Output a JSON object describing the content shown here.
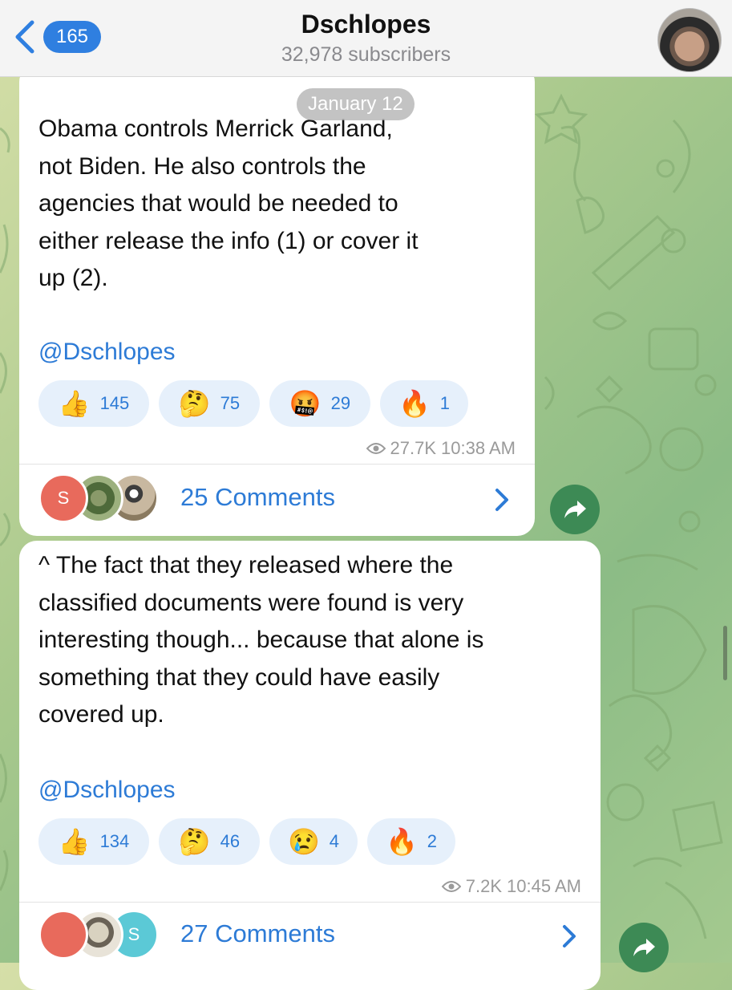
{
  "header": {
    "back_count": "165",
    "channel_name": "Dschlopes",
    "subscribers": "32,978 subscribers"
  },
  "date_separator": "January 12",
  "messages": [
    {
      "text": "Obama controls Merrick Garland,\nnot Biden.  He also controls the\nagencies that would be needed to\neither release the info (1) or cover it\nup (2).",
      "mention": "@Dschlopes",
      "reactions": [
        {
          "emoji": "👍",
          "count": "145"
        },
        {
          "emoji": "🤔",
          "count": "75"
        },
        {
          "emoji": "🤬",
          "count": "29"
        },
        {
          "emoji": "🔥",
          "count": "1"
        }
      ],
      "views": "27.7K",
      "time": "10:38 AM",
      "comments": "25 Comments",
      "comment_avatar_letter": "S"
    },
    {
      "text": "^ The fact that they released where the\nclassified documents were found is very\ninteresting though... because that alone is\nsomething that they could have easily\ncovered up.",
      "mention": "@Dschlopes",
      "reactions": [
        {
          "emoji": "👍",
          "count": "134"
        },
        {
          "emoji": "🤔",
          "count": "46"
        },
        {
          "emoji": "😢",
          "count": "4"
        },
        {
          "emoji": "🔥",
          "count": "2"
        }
      ],
      "views": "7.2K",
      "time": "10:45 AM",
      "comments": "27 Comments",
      "comment_avatar_letter": "S"
    }
  ],
  "colors": {
    "accent": "#2d7bd6",
    "header_bg": "#f4f4f4",
    "share_button": "#3d8a55"
  }
}
